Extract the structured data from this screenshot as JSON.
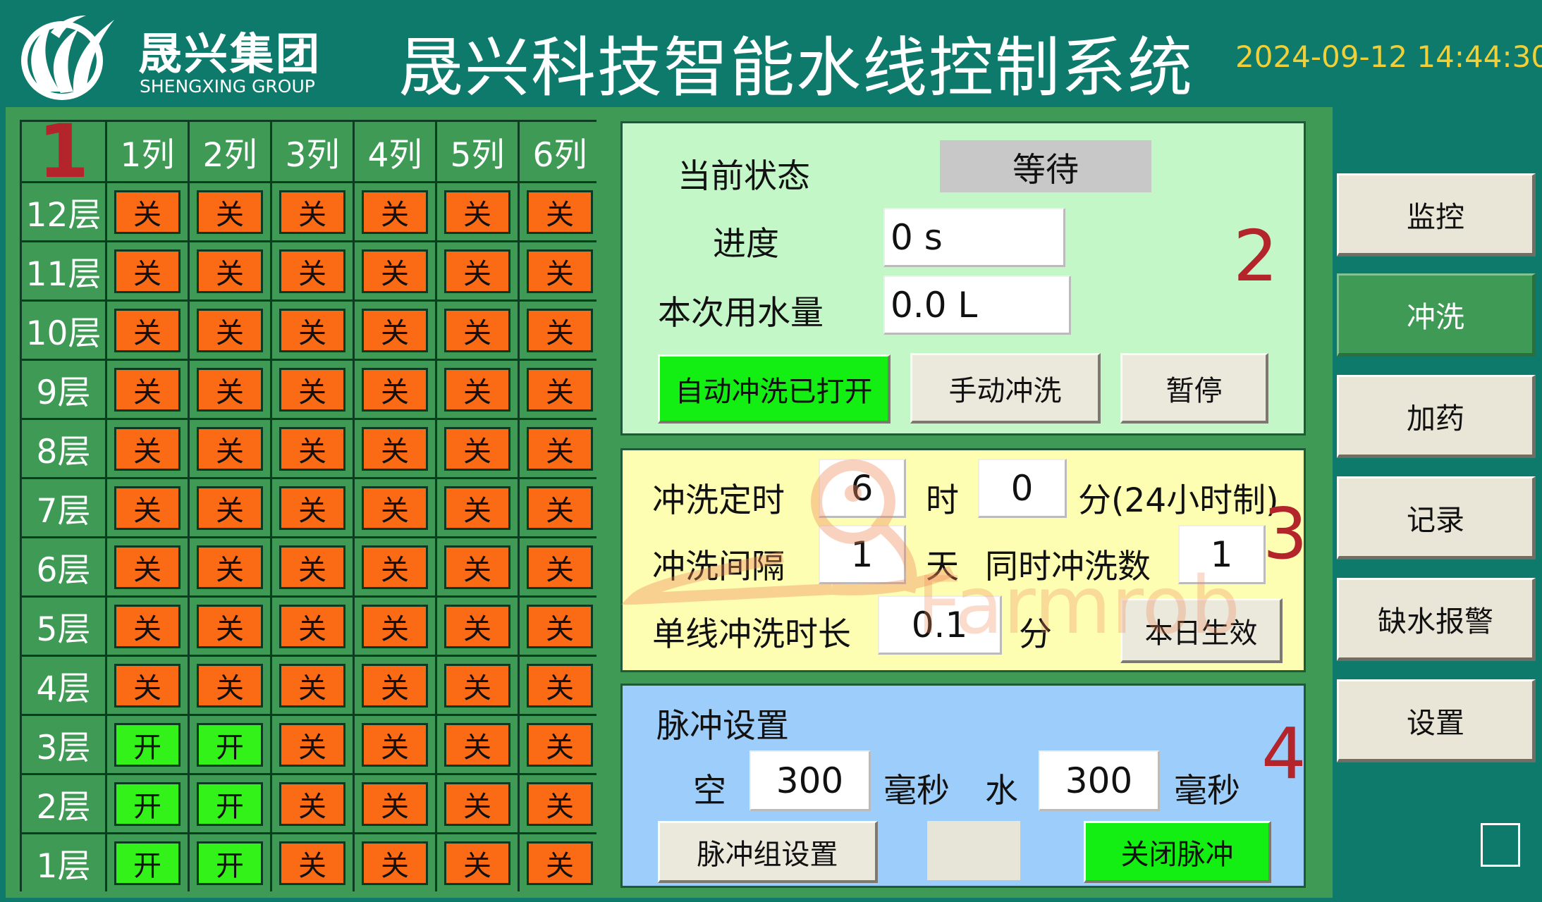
{
  "header": {
    "brand_name": "晟兴集团",
    "brand_sub": "SHENGXING GROUP",
    "title": "晟兴科技智能水线控制系统",
    "datetime": "2024-09-12 14:44:30",
    "logo_icon": "sheng-xing-leaf-logo-icon"
  },
  "grid": {
    "badge": "1",
    "columns": [
      "1列",
      "2列",
      "3列",
      "4列",
      "5列",
      "6列"
    ],
    "rows": [
      {
        "label": "12层",
        "cells": [
          "关",
          "关",
          "关",
          "关",
          "关",
          "关"
        ]
      },
      {
        "label": "11层",
        "cells": [
          "关",
          "关",
          "关",
          "关",
          "关",
          "关"
        ]
      },
      {
        "label": "10层",
        "cells": [
          "关",
          "关",
          "关",
          "关",
          "关",
          "关"
        ]
      },
      {
        "label": "9层",
        "cells": [
          "关",
          "关",
          "关",
          "关",
          "关",
          "关"
        ]
      },
      {
        "label": "8层",
        "cells": [
          "关",
          "关",
          "关",
          "关",
          "关",
          "关"
        ]
      },
      {
        "label": "7层",
        "cells": [
          "关",
          "关",
          "关",
          "关",
          "关",
          "关"
        ]
      },
      {
        "label": "6层",
        "cells": [
          "关",
          "关",
          "关",
          "关",
          "关",
          "关"
        ]
      },
      {
        "label": "5层",
        "cells": [
          "关",
          "关",
          "关",
          "关",
          "关",
          "关"
        ]
      },
      {
        "label": "4层",
        "cells": [
          "关",
          "关",
          "关",
          "关",
          "关",
          "关"
        ]
      },
      {
        "label": "3层",
        "cells": [
          "开",
          "开",
          "关",
          "关",
          "关",
          "关"
        ]
      },
      {
        "label": "2层",
        "cells": [
          "开",
          "开",
          "关",
          "关",
          "关",
          "关"
        ]
      },
      {
        "label": "1层",
        "cells": [
          "开",
          "开",
          "关",
          "关",
          "关",
          "关"
        ]
      }
    ],
    "on_color": "#33f21a",
    "off_color": "#fb6a14"
  },
  "status": {
    "badge": "2",
    "state_label": "当前状态",
    "state_value": "等待",
    "progress_label": "进度",
    "progress_value": "0 s",
    "water_label": "本次用水量",
    "water_value": "0.0 L",
    "auto_flush_button": "自动冲洗已打开",
    "manual_flush_button": "手动冲洗",
    "pause_button": "暂停"
  },
  "timer": {
    "badge": "3",
    "flush_time_label": "冲洗定时",
    "hour_value": "6",
    "hour_unit": "时",
    "minute_value": "0",
    "minute_unit": "分(24小时制)",
    "interval_label": "冲洗间隔",
    "interval_value": "1",
    "interval_unit": "天",
    "simultaneous_label": "同时冲洗数",
    "simultaneous_value": "1",
    "single_duration_label": "单线冲洗时长",
    "single_duration_value": "0.1",
    "single_duration_unit": "分",
    "apply_today_button": "本日生效",
    "watermark_text": "Farmrob"
  },
  "pulse": {
    "badge": "4",
    "title": "脉冲设置",
    "air_label": "空",
    "air_value": "300",
    "air_unit": "毫秒",
    "water_label": "水",
    "water_value": "300",
    "water_unit": "毫秒",
    "group_settings_button": "脉冲组设置",
    "close_pulse_button": "关闭脉冲"
  },
  "nav": [
    {
      "label": "监控",
      "active": false
    },
    {
      "label": "冲洗",
      "active": true
    },
    {
      "label": "加药",
      "active": false
    },
    {
      "label": "记录",
      "active": false
    },
    {
      "label": "缺水报警",
      "active": false
    },
    {
      "label": "设置",
      "active": false
    }
  ]
}
